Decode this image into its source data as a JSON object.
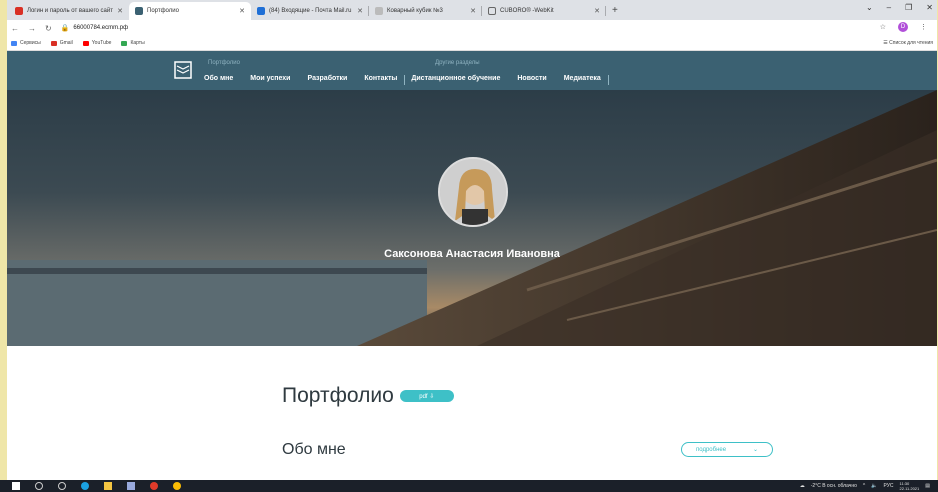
{
  "browser": {
    "tabs": [
      {
        "label": "Логин и пароль от вашего сайт",
        "color": "#d93025"
      },
      {
        "label": "Портфолио",
        "color": "#3b6172",
        "active": true
      },
      {
        "label": "(84) Входящие - Почта Mail.ru",
        "color": "#1f6fd6"
      },
      {
        "label": "Коварный кубик №3",
        "color": "#888888"
      },
      {
        "label": "CUBORO® -WebKit",
        "color": "#666666"
      }
    ],
    "new_tab": "+",
    "window_controls": [
      "⌄",
      "–",
      "❐",
      "✕"
    ],
    "url": "66000784.ecmm.рф",
    "bookmarks": [
      {
        "label": "Сервисы",
        "color": "#4285f4"
      },
      {
        "label": "Gmail",
        "color": "#d93025"
      },
      {
        "label": "YouTube",
        "color": "#ff0000"
      },
      {
        "label": "Карты",
        "color": "#34a853"
      }
    ],
    "reading_list": "Список для чтения",
    "profile_initial": "D"
  },
  "site": {
    "group1_label": "Портфолио",
    "group2_label": "Другие разделы",
    "nav": [
      "Обо мне",
      "Мои успехи",
      "Разработки",
      "Контакты",
      "Дистанционное обучение",
      "Новости",
      "Медиатека"
    ],
    "hero_name": "Саксонова Анастасия Ивановна",
    "section_title": "Портфолио",
    "pdf_label": "pdf ⇩",
    "about_title": "Обо мне",
    "more_label": "подробнее",
    "accent_color": "#3ec0c7",
    "nav_bg": "#3b6172"
  },
  "taskbar": {
    "weather": "-2°C  В осн. облачно",
    "lang": "РУС",
    "time": "11:30",
    "date": "22.11.2021"
  }
}
